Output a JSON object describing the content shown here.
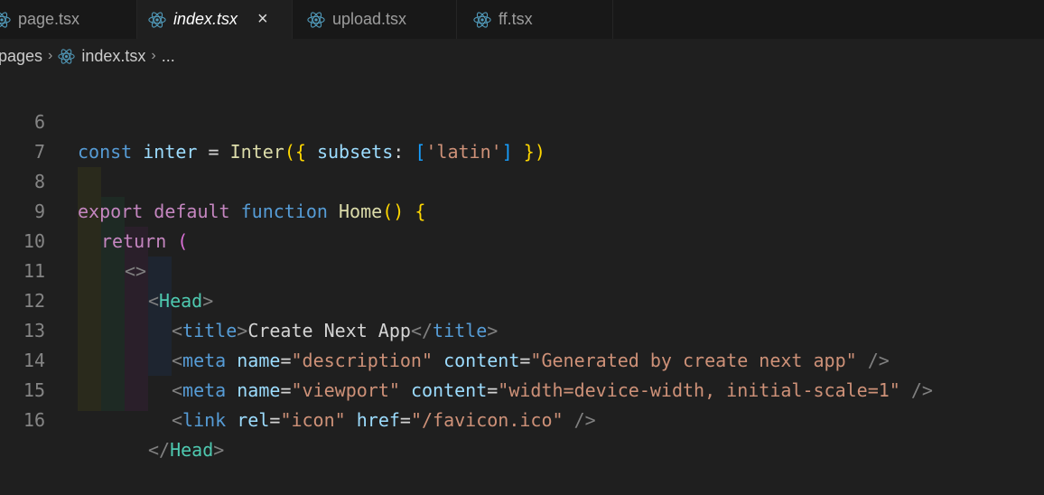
{
  "tabs": [
    {
      "label": "page.tsx",
      "active": false
    },
    {
      "label": "index.tsx",
      "active": true
    },
    {
      "label": "upload.tsx",
      "active": false
    },
    {
      "label": "ff.tsx",
      "active": false
    }
  ],
  "close_glyph": "×",
  "breadcrumb": {
    "folder": "pages",
    "file": "index.tsx",
    "more": "..."
  },
  "lines": [
    {
      "num": "6"
    },
    {
      "num": "7"
    },
    {
      "num": "8"
    },
    {
      "num": "9"
    },
    {
      "num": "10"
    },
    {
      "num": "11"
    },
    {
      "num": "12"
    },
    {
      "num": "13"
    },
    {
      "num": "14"
    },
    {
      "num": "15"
    },
    {
      "num": "16"
    }
  ],
  "code": {
    "l6": {
      "kw": "const",
      "name": "inter",
      "eq": " = ",
      "fn": "Inter",
      "open": "({",
      "key": " subsets",
      "colon": ": ",
      "arr_open": "[",
      "str": "'latin'",
      "arr_close": "]",
      "close": " })"
    },
    "l8": {
      "kw1": "export",
      "kw2": "default",
      "kw3": "function",
      "fn": "Home",
      "parens": "()",
      "brace": "{"
    },
    "l9": {
      "kw": "return",
      "paren": "("
    },
    "l10": {
      "frag": "<>"
    },
    "l11": {
      "lt": "<",
      "tag": "Head",
      "gt": ">"
    },
    "l12": {
      "lt": "<",
      "tag": "title",
      "gt": ">",
      "text": "Create Next App",
      "lt2": "</",
      "tag2": "title",
      "gt2": ">"
    },
    "l13": {
      "lt": "<",
      "tag": "meta",
      "a1": "name",
      "eq1": "=",
      "v1": "\"description\"",
      "a2": "content",
      "eq2": "=",
      "v2": "\"Generated by create next app\"",
      "end": " />"
    },
    "l14": {
      "lt": "<",
      "tag": "meta",
      "a1": "name",
      "eq1": "=",
      "v1": "\"viewport\"",
      "a2": "content",
      "eq2": "=",
      "v2": "\"width=device-width, initial-scale=1\"",
      "end": " />"
    },
    "l15": {
      "lt": "<",
      "tag": "link",
      "a1": "rel",
      "eq1": "=",
      "v1": "\"icon\"",
      "a2": "href",
      "eq2": "=",
      "v2": "\"/favicon.ico\"",
      "end": " />"
    },
    "l16": {
      "lt": "</",
      "tag": "Head",
      "gt": ">"
    }
  },
  "colors": {
    "accent": "#569cd6",
    "background": "#1f1f1f",
    "tab_inactive": "#181818"
  }
}
